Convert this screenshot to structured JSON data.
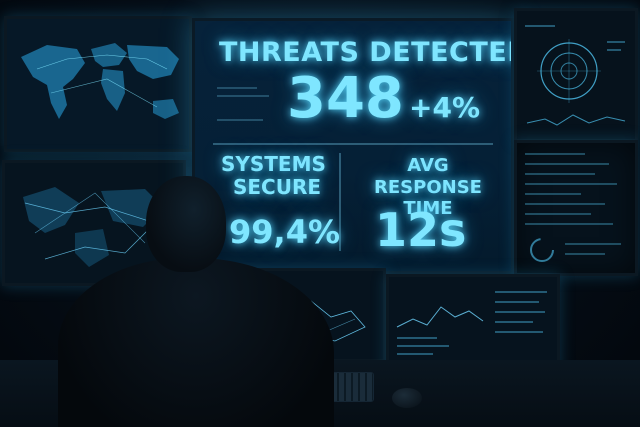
{
  "dashboard": {
    "threats": {
      "title": "THREATS DETECTED",
      "count": "348",
      "change": "+4%"
    },
    "systems": {
      "label_line1": "SYSTEMS",
      "label_line2": "SECURE",
      "value": "99,4%"
    },
    "response": {
      "label_line1": "AVG RESPONSE",
      "label_line2": "TIME",
      "value": "12s"
    }
  },
  "colors": {
    "accent_text": "#7fe6ff",
    "panel_background": "#052036",
    "room_background": "#050d16",
    "map_glow": "#2aa8e6"
  }
}
